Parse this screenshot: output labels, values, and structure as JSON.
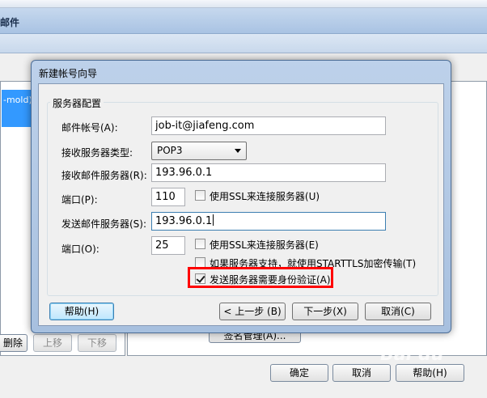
{
  "background": {
    "window_title": "邮件",
    "list_selected_item": "-mold)",
    "buttons": {
      "delete": "删除",
      "move_up": "上移",
      "move_down": "下移",
      "signature_manage": "签名管理(A)...",
      "ok": "确定",
      "cancel": "取消",
      "help": "帮助(H)"
    }
  },
  "dialog": {
    "title": "新建帐号向导",
    "group_title": "服务器配置",
    "fields": {
      "account_label": "邮件帐号(A):",
      "account_value": "job-it@jiafeng.com",
      "incoming_type_label": "接收服务器类型:",
      "incoming_type_value": "POP3",
      "incoming_server_label": "接收邮件服务器(R):",
      "incoming_server_value": "193.96.0.1",
      "incoming_port_label": "端口(P):",
      "incoming_port_value": "110",
      "incoming_ssl_label": "使用SSL来连接服务器(U)",
      "outgoing_server_label": "发送邮件服务器(S):",
      "outgoing_server_value": "193.96.0.1",
      "outgoing_port_label": "端口(O):",
      "outgoing_port_value": "25",
      "outgoing_ssl_label": "使用SSL来连接服务器(E)",
      "starttls_label": "如果服务器支持，就使用STARTTLS加密传输(T)",
      "auth_label": "发送服务器需要身份验证(A)"
    },
    "checks": {
      "incoming_ssl": false,
      "outgoing_ssl": false,
      "starttls": false,
      "auth": true
    },
    "buttons": {
      "help": "帮助(H)",
      "back": "< 上一步 (B)",
      "next": "下一步(X)",
      "cancel": "取消(C)"
    }
  },
  "watermark": "Bai du",
  "colors": {
    "highlight": "#ff0000",
    "selection": "#3399ff"
  }
}
